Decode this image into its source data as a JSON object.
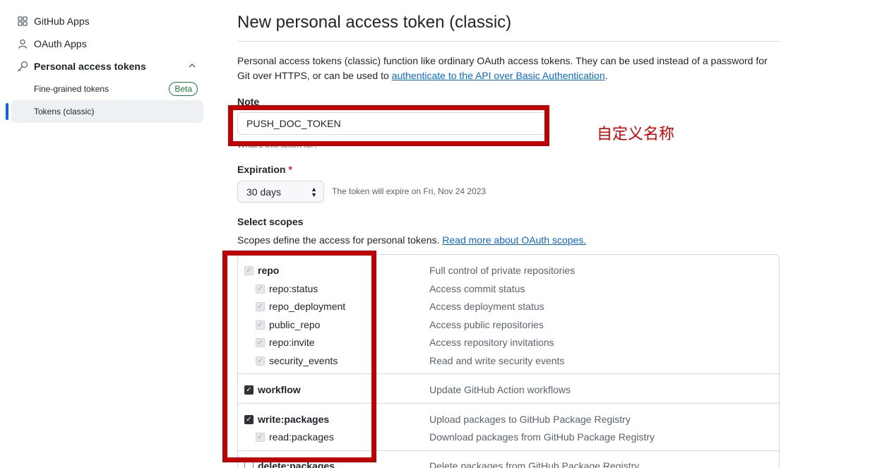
{
  "sidebar": {
    "items": [
      {
        "label": "GitHub Apps",
        "icon": "apps-grid-icon"
      },
      {
        "label": "OAuth Apps",
        "icon": "person-icon"
      },
      {
        "label": "Personal access tokens",
        "icon": "key-icon"
      }
    ],
    "sub_items": [
      {
        "label": "Fine-grained tokens",
        "badge": "Beta"
      },
      {
        "label": "Tokens (classic)"
      }
    ]
  },
  "main": {
    "title": "New personal access token (classic)",
    "description_prefix": "Personal access tokens (classic) function like ordinary OAuth access tokens. They can be used instead of a password for Git over HTTPS, or can be used to ",
    "description_link": "authenticate to the API over Basic Authentication",
    "description_suffix": ".",
    "note": {
      "label": "Note",
      "value": "PUSH_DOC_TOKEN",
      "hint": "What's this token for?"
    },
    "expiration": {
      "label": "Expiration",
      "required_mark": "*",
      "selected": "30 days",
      "note": "The token will expire on Fri, Nov 24 2023"
    },
    "scopes": {
      "heading": "Select scopes",
      "description": "Scopes define the access for personal tokens. ",
      "link": "Read more about OAuth scopes.",
      "items": [
        {
          "name": "repo",
          "description": "Full control of private repositories",
          "state": "disabled-checked"
        },
        {
          "name": "repo:status",
          "description": "Access commit status",
          "state": "disabled-checked"
        },
        {
          "name": "repo_deployment",
          "description": "Access deployment status",
          "state": "disabled-checked"
        },
        {
          "name": "public_repo",
          "description": "Access public repositories",
          "state": "disabled-checked"
        },
        {
          "name": "repo:invite",
          "description": "Access repository invitations",
          "state": "disabled-checked"
        },
        {
          "name": "security_events",
          "description": "Read and write security events",
          "state": "disabled-checked"
        },
        {
          "name": "workflow",
          "description": "Update GitHub Action workflows",
          "state": "checked"
        },
        {
          "name": "write:packages",
          "description": "Upload packages to GitHub Package Registry",
          "state": "checked"
        },
        {
          "name": "read:packages",
          "description": "Download packages from GitHub Package Registry",
          "state": "disabled-checked"
        },
        {
          "name": "delete:packages",
          "description": "Delete packages from GitHub Package Registry",
          "state": "unchecked"
        }
      ]
    }
  },
  "annotation": {
    "text": "自定义名称",
    "color": "#c00000"
  }
}
